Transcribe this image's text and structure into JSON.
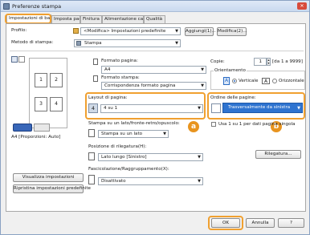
{
  "window": {
    "title": "Preferenze stampa",
    "close": "✕"
  },
  "tabs": [
    {
      "label": "Impostazioni di base"
    },
    {
      "label": "Imposta pagina"
    },
    {
      "label": "Finitura"
    },
    {
      "label": "Alimentazione carta"
    },
    {
      "label": "Qualità"
    }
  ],
  "profile": {
    "label": "Profilo:",
    "value": "<Modifica> Impostazioni predefinite",
    "add_button": "Aggiungi(1)...",
    "edit_button": "Modifica(2)..."
  },
  "output_method": {
    "label": "Metodo di stampa:",
    "value": "Stampa"
  },
  "page_size": {
    "label": "Formato pagina:",
    "value": "A4"
  },
  "output_size": {
    "label": "Formato stampa:",
    "value": "Corrispondenza formato pagina"
  },
  "copies": {
    "label": "Copie:",
    "value": "1",
    "range": "[da 1 a 9999]"
  },
  "orientation": {
    "label": "Orientamento",
    "portrait": "Verticale",
    "landscape": "Orizzontale"
  },
  "page_layout": {
    "label": "Layout di pagina:",
    "value": "4 su 1",
    "icon_text": "4"
  },
  "page_order": {
    "label": "Ordine delle pagine:",
    "value": "Trasversalmente da sinistra"
  },
  "single_page_data": {
    "label": "Usa 1 su 1 per dati pagina singola"
  },
  "duplex": {
    "label": "Stampa su un lato/fronte-retro/opuscolo:",
    "value": "Stampa su un lato"
  },
  "binding": {
    "label": "Posizione di rilegatura(H):",
    "value": "Lato lungo [Sinistro]",
    "button": "Rilegatura..."
  },
  "collate": {
    "label": "Fascicolazione/Raggruppamento(X):",
    "value": "Disattivato"
  },
  "preview": {
    "pages": [
      "1",
      "2",
      "3",
      "4"
    ],
    "paper_info": "A4 [Proporzioni: Auto]"
  },
  "left_buttons": {
    "view_settings": "Visualizza impostazioni",
    "restore_defaults": "Ripristina impostazioni predefinite"
  },
  "footer": {
    "ok": "OK",
    "cancel": "Annulla",
    "help": "?"
  },
  "annotations": {
    "a": "a",
    "b": "b"
  },
  "colors": {
    "highlight": "#f0a030",
    "badge": "#e8941f",
    "selected_blue": "#2a6bc4"
  }
}
